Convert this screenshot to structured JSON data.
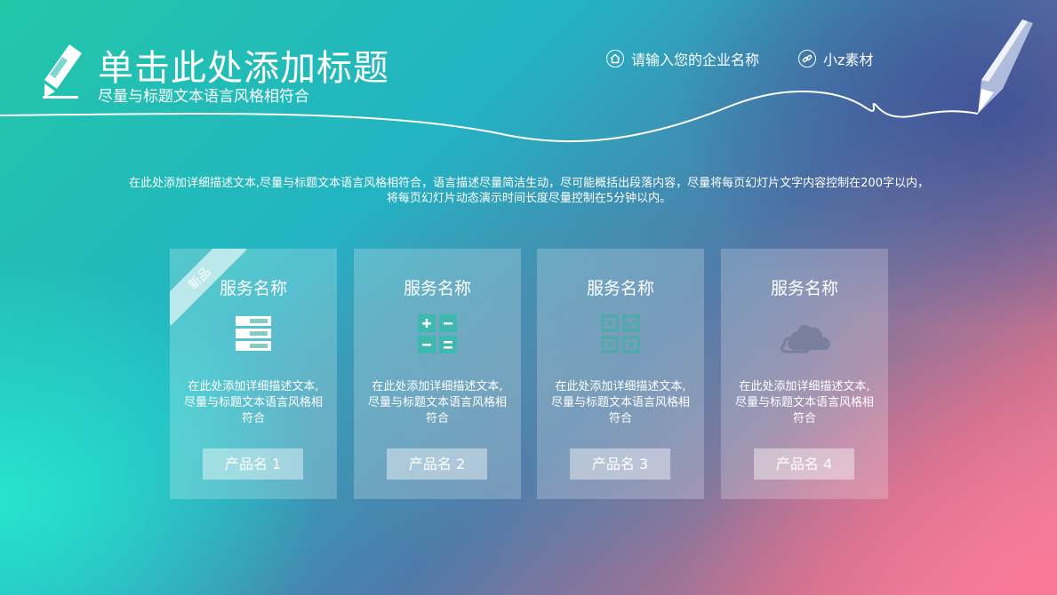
{
  "header": {
    "title": "单击此处添加标题",
    "subtitle": "尽量与标题文本语言风格相符合",
    "nav": [
      {
        "label": "请输入您的企业名称",
        "icon": "home-icon"
      },
      {
        "label": "小z素材",
        "icon": "link-icon"
      }
    ]
  },
  "description": "在此处添加详细描述文本,尽量与标题文本语言风格相符合，语言描述尽量简洁生动，尽可能概括出段落内容，尽量将每页幻灯片文字内容控制在200字以内，将每页幻灯片动态演示时间长度尽量控制在5分钟以内。",
  "cards": [
    {
      "title": "服务名称",
      "icon": "server-icon",
      "text": "在此处添加详细描述文本,尽量与标题文本语言风格相符合",
      "button": "产品名 1",
      "ribbon": "新品"
    },
    {
      "title": "服务名称",
      "icon": "calculator-icon",
      "text": "在此处添加详细描述文本,尽量与标题文本语言风格相符合",
      "button": "产品名 2"
    },
    {
      "title": "服务名称",
      "icon": "checklist-grid-icon",
      "text": "在此处添加详细描述文本,尽量与标题文本语言风格相符合",
      "button": "产品名 3"
    },
    {
      "title": "服务名称",
      "icon": "cloud-icon",
      "text": "在此处添加详细描述文本,尽量与标题文本语言风格相符合",
      "button": "产品名 4"
    }
  ],
  "colors": {
    "icon_tint": "#4bbdb4",
    "text": "#ffffff"
  }
}
